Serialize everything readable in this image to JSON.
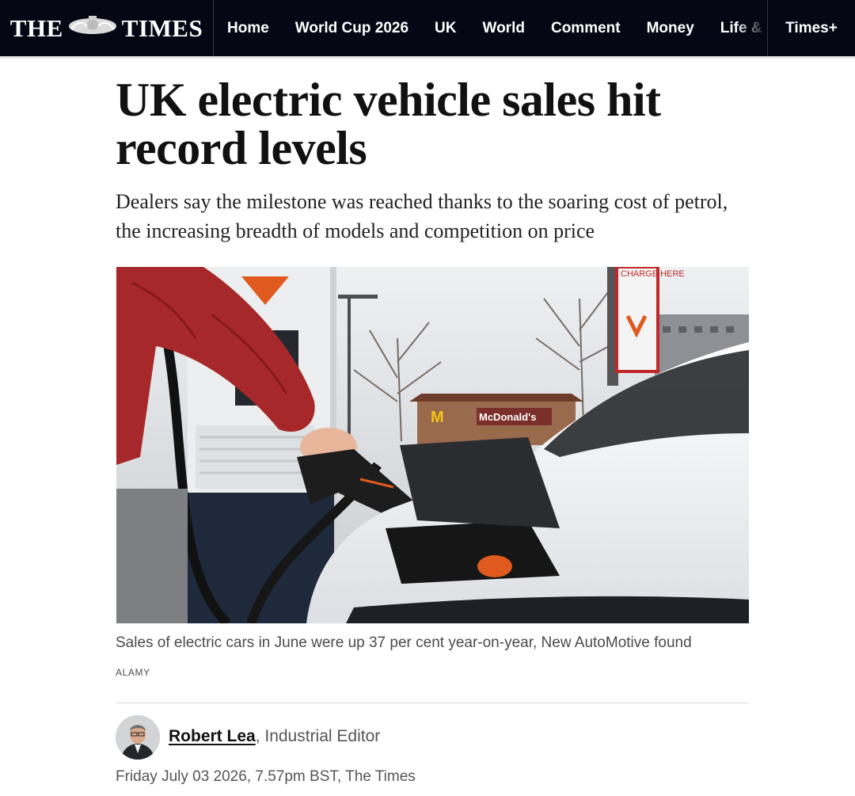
{
  "brand": {
    "logo_left": "THE",
    "logo_right": "TIMES"
  },
  "nav": {
    "items": [
      "Home",
      "World Cup 2026",
      "UK",
      "World",
      "Comment",
      "Money",
      "Life & Style"
    ],
    "timesplus": "Times+"
  },
  "article": {
    "headline": "UK electric vehicle sales hit record levels",
    "standfirst": "Dealers say the milestone was reached thanks to the soaring cost of petrol, the increasing breadth of models and competition on price",
    "image": {
      "sign_text": "CHARGE HERE",
      "store_sign": "McDonald's"
    },
    "caption": "Sales of electric cars in June were up 37 per cent year-on-year, New AutoMotive found",
    "credit": "ALAMY",
    "author": "Robert Lea",
    "author_role": ", Industrial Editor",
    "dateline": "Friday July 03 2026, 7.57pm BST, The Times"
  },
  "colors": {
    "nav_bg": "#050814",
    "text": "#111111",
    "muted": "#555555",
    "jacket": "#a7282a",
    "brand_orange": "#e05a1f"
  }
}
